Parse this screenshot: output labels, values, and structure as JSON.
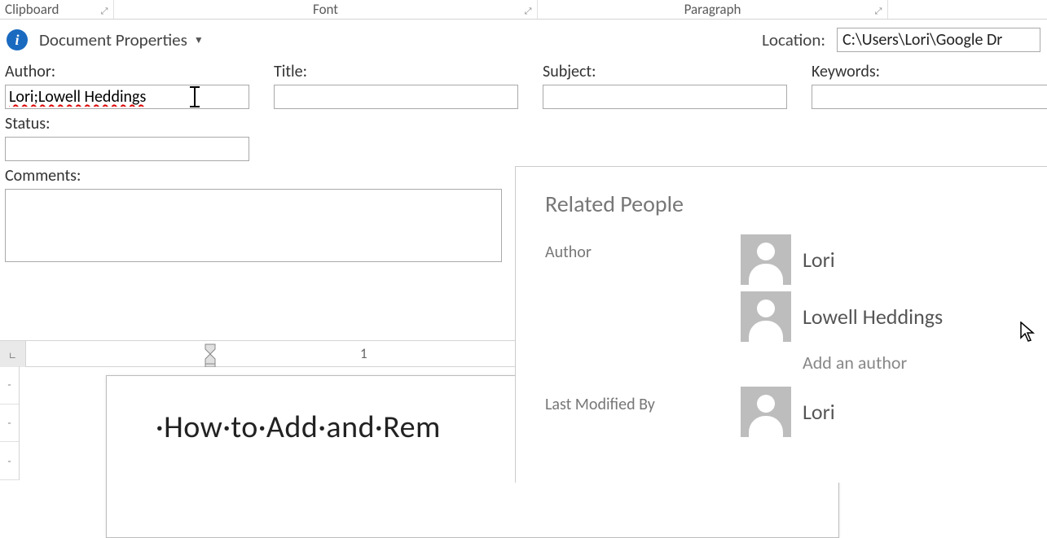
{
  "ribbon": {
    "clipboard": "Clipboard",
    "font": "Font",
    "paragraph": "Paragraph"
  },
  "propsBar": {
    "title": "Document Properties",
    "locationLabel": "Location:",
    "locationValue": "C:\\Users\\Lori\\Google Dr"
  },
  "fields": {
    "authorLabel": "Author:",
    "authorValue": "Lori;Lowell Heddings",
    "titleLabel": "Title:",
    "titleValue": "",
    "subjectLabel": "Subject:",
    "subjectValue": "",
    "keywordsLabel": "Keywords:",
    "keywordsValue": "",
    "statusLabel": "Status:",
    "statusValue": "",
    "commentsLabel": "Comments:",
    "commentsValue": ""
  },
  "ruler": {
    "tick1": "1"
  },
  "docText": "·How·to·Add·and·Rem",
  "panel": {
    "title": "Related People",
    "authorKey": "Author",
    "authors": [
      "Lori",
      "Lowell Heddings"
    ],
    "addAuthor": "Add an author",
    "lastModKey": "Last Modified By",
    "lastModBy": "Lori"
  }
}
